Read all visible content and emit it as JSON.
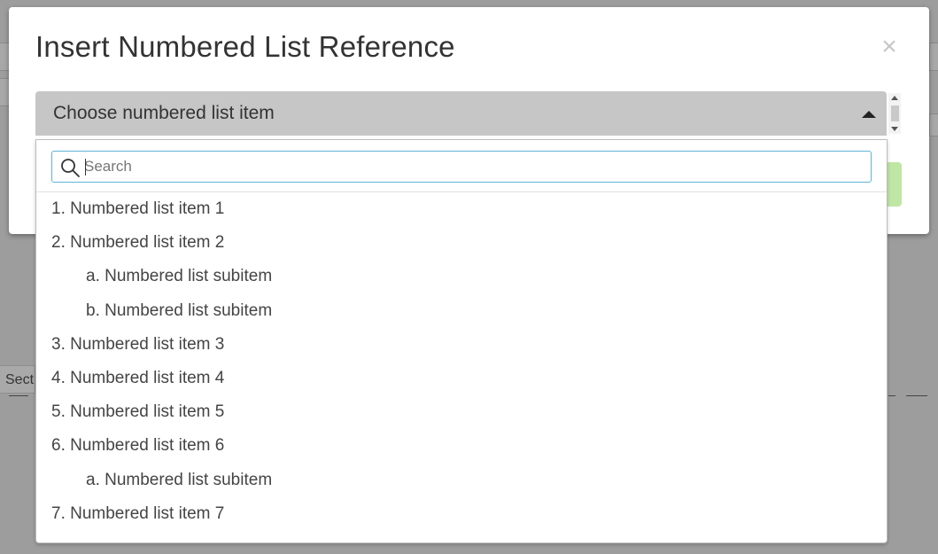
{
  "background": {
    "section_fragment": "Sect"
  },
  "modal": {
    "title": "Insert Numbered List Reference",
    "close_label": "×",
    "select": {
      "label": "Choose numbered list item",
      "expanded": true
    },
    "search": {
      "placeholder": "Search",
      "value": ""
    },
    "items": [
      {
        "label": "1. Numbered list item 1",
        "level": 0
      },
      {
        "label": "2. Numbered list item 2",
        "level": 0
      },
      {
        "label": "a. Numbered list subitem",
        "level": 1
      },
      {
        "label": "b. Numbered list subitem",
        "level": 1
      },
      {
        "label": "3. Numbered list item 3",
        "level": 0
      },
      {
        "label": "4. Numbered list item 4",
        "level": 0
      },
      {
        "label": "5. Numbered list item 5",
        "level": 0
      },
      {
        "label": "6. Numbered list item 6",
        "level": 0
      },
      {
        "label": "a. Numbered list subitem",
        "level": 1
      },
      {
        "label": "7. Numbered list item 7",
        "level": 0
      }
    ]
  },
  "colors": {
    "overlay": "#9d9d9d",
    "select_bg": "#c6c6c6",
    "search_border": "#5fb3d6",
    "confirm_green": "#bfe6a4"
  }
}
